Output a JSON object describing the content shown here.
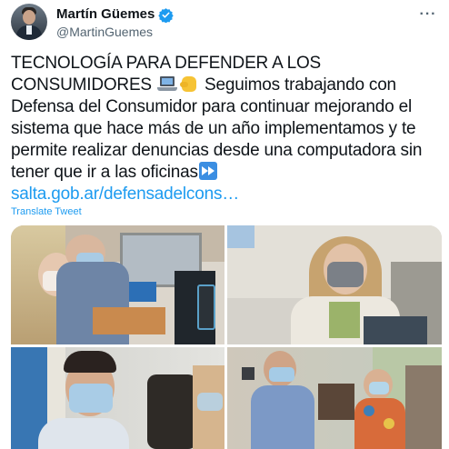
{
  "tweet": {
    "author_name": "Martín Güemes",
    "handle": "@MartinGuemes",
    "more_icon": "more-horizontal-icon",
    "verified_color": "#1d9bf0",
    "text_lines": [
      "TECNOLOGÍA PARA DEFENDER A LOS",
      " Seguimos trabajando con",
      "Defensa del Consumidor para continuar mejorando el",
      "sistema que hace más de un año implementamos y te",
      "permite realizar denuncias desde una computadora sin",
      "tener que ir a las oficinas"
    ],
    "line2_prefix": "CONSUMIDORES ",
    "emojis": [
      "laptop-emoji",
      "raised-fist-emoji",
      "fast-forward-emoji"
    ],
    "link": "salta.gob.ar/defensadelcons…",
    "translate_label": "Translate Tweet",
    "link_color": "#1d9bf0"
  },
  "media": {
    "photos": [
      "photo-woman-at-office-desk",
      "photo-woman-at-desk-masked",
      "photo-man-masked-portrait",
      "photo-group-at-service-counter"
    ]
  }
}
